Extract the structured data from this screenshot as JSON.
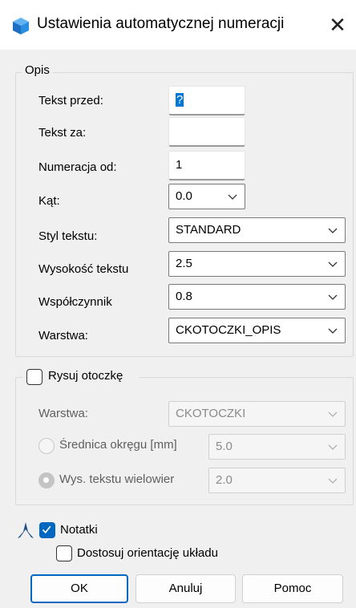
{
  "window": {
    "title": "Ustawienia automatycznej numeracji",
    "close": "✕"
  },
  "opis": {
    "legend": "Opis",
    "tekst_przed": {
      "label": "Tekst przed:",
      "value": "?"
    },
    "tekst_za": {
      "label": "Tekst za:",
      "value": ""
    },
    "numeracja_od": {
      "label": "Numeracja od:",
      "value": "1"
    },
    "kat": {
      "label": "Kąt:",
      "value": "0.0"
    },
    "styl_tekstu": {
      "label": "Styl tekstu:",
      "value": "STANDARD"
    },
    "wysokosc_tekstu": {
      "label": "Wysokość tekstu",
      "value": "2.5"
    },
    "wspolczynnik": {
      "label": "Współczynnik",
      "value": "0.8"
    },
    "warstwa": {
      "label": "Warstwa:",
      "value": "CKOTOCZKI_OPIS"
    }
  },
  "otoczka": {
    "checkbox_label": "Rysuj otoczkę",
    "checked": false,
    "warstwa": {
      "label": "Warstwa:",
      "value": "CKOTOCZKI"
    },
    "srednica": {
      "label": "Średnica okręgu [mm]",
      "value": "5.0"
    },
    "wys_tekstu": {
      "label": "Wys. tekstu wielowier",
      "value": "2.0"
    }
  },
  "notatki": {
    "label": "Notatki",
    "checked": true
  },
  "dostosuj": {
    "label": "Dostosuj orientację układu",
    "checked": false
  },
  "buttons": {
    "ok": "OK",
    "cancel": "Anuluj",
    "help": "Pomoc"
  },
  "colors": {
    "accent": "#0067c0",
    "selection": "#0078d7",
    "background": "#f0f0f0"
  }
}
